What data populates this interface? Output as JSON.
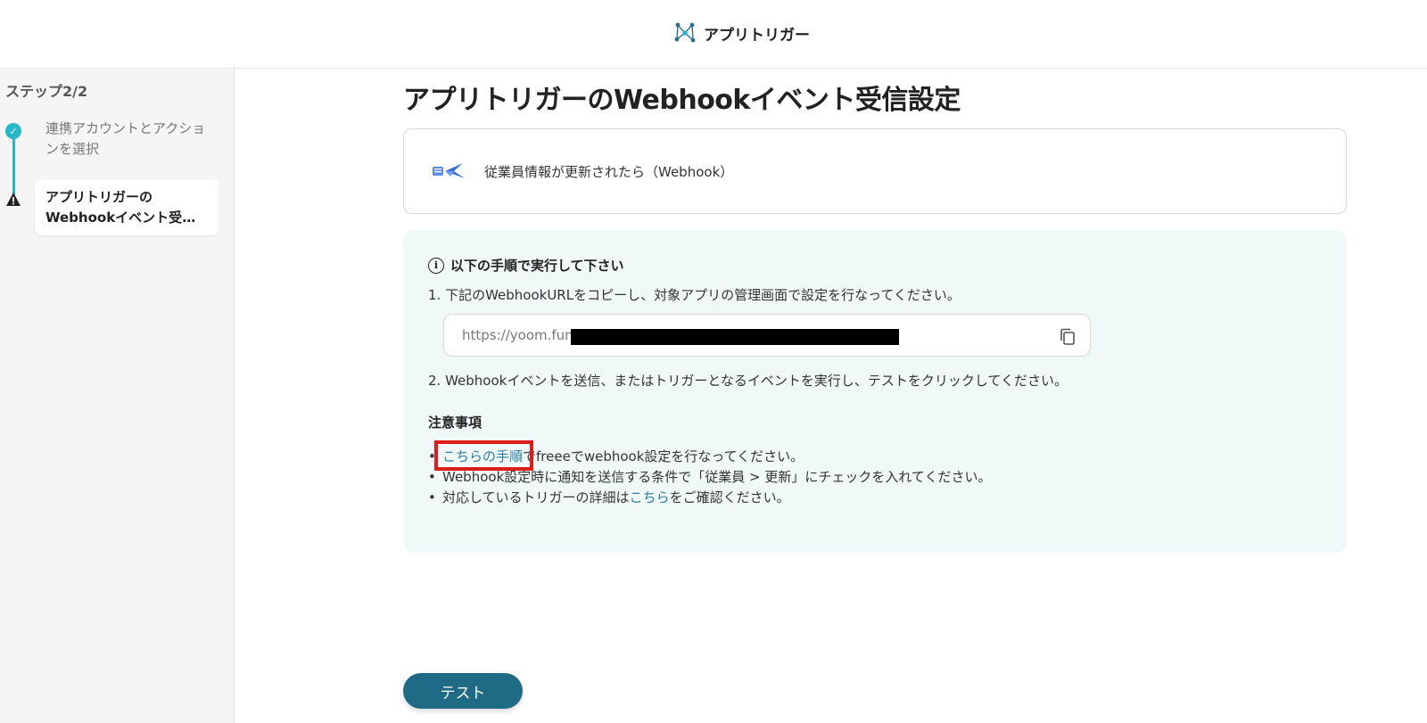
{
  "header": {
    "app_name": "アプリトリガー",
    "logo_icon": "network-nodes-icon"
  },
  "sidebar": {
    "step_count": "ステップ2/2",
    "steps": [
      {
        "label": "連携アカウントとアクションを選択",
        "status": "complete"
      },
      {
        "label_line1": "アプリトリガーの",
        "label_line2": "Webhookイベント受信...",
        "status": "warning"
      }
    ]
  },
  "main": {
    "title": "アプリトリガーのWebhookイベント受信設定",
    "trigger": {
      "label": "従業員情報が更新されたら（Webhook）",
      "icon": "freee-hr-app-icon"
    },
    "instructions": {
      "heading": "以下の手順で実行して下さい",
      "step1": "1. 下記のWebhookURLをコピーし、対象アプリの管理画面で設定を行なってください。",
      "url_prefix": "https://yoom.fun/",
      "step2": "2. Webhookイベントを送信、またはトリガーとなるイベントを実行し、テストをクリックしてください。",
      "notes_title": "注意事項",
      "notes": [
        {
          "link": "こちらの手順",
          "text": "でfreeeでwebhook設定を行なってください。"
        },
        {
          "text": "Webhook設定時に通知を送信する条件で「従業員 > 更新」にチェックを入れてください。"
        },
        {
          "text_before": "対応しているトリガーの詳細は",
          "link": "こちら",
          "text_after": "をご確認ください。"
        }
      ]
    },
    "test_button_label": "テスト"
  },
  "colors": {
    "accent_teal": "#26b8c8",
    "button_bg": "#1f6b86",
    "link": "#2b7da0",
    "panel_bg": "#f1f8f8",
    "highlight_red": "#e01b1b"
  }
}
